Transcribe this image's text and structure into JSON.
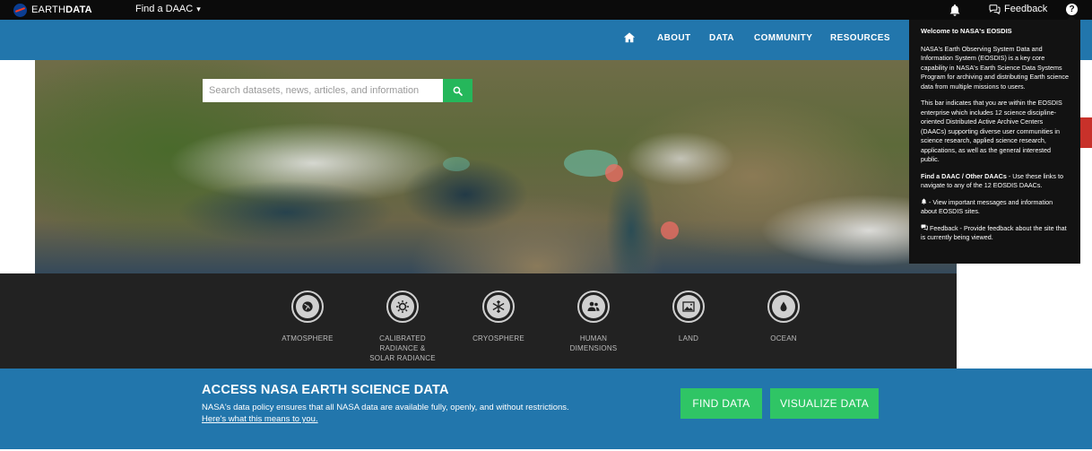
{
  "topbar": {
    "brand_light": "EARTH",
    "brand_bold": "DATA",
    "find_daac": "Find a DAAC",
    "find_daac_caret": "▾",
    "feedback": "Feedback",
    "help": "?"
  },
  "nav": {
    "about": "ABOUT",
    "data": "DATA",
    "community": "COMMUNITY",
    "resources": "RESOURCES"
  },
  "search": {
    "placeholder": "Search datasets, news, articles, and information"
  },
  "categories": [
    {
      "label_lines": [
        "ATMOSPHERE"
      ],
      "icon": "globe-icon"
    },
    {
      "label_lines": [
        "CALIBRATED",
        "RADIANCE &",
        "SOLAR RADIANCE"
      ],
      "icon": "sun-icon"
    },
    {
      "label_lines": [
        "CRYOSPHERE"
      ],
      "icon": "snowflake-icon"
    },
    {
      "label_lines": [
        "HUMAN",
        "DIMENSIONS"
      ],
      "icon": "people-icon"
    },
    {
      "label_lines": [
        "LAND"
      ],
      "icon": "landscape-icon"
    },
    {
      "label_lines": [
        "OCEAN"
      ],
      "icon": "water-drop-icon"
    }
  ],
  "banner": {
    "title": "ACCESS NASA EARTH SCIENCE DATA",
    "text": "NASA's data policy ensures that all NASA data are available fully, openly, and without restrictions.",
    "link": "Here's what this means to you.",
    "find_data": "FIND DATA",
    "visualize_data": "VISUALIZE DATA"
  },
  "popover": {
    "title": "Welcome to NASA's EOSDIS",
    "p1": "NASA's Earth Observing System Data and Information System (EOSDIS) is a key core capability in NASA's Earth Science Data Systems Program for archiving and distributing Earth science data from multiple missions to users.",
    "p2": "This bar indicates that you are within the EOSDIS enterprise which includes 12 science discipline-oriented Distributed Active Archive Centers (DAACs) supporting diverse user communities in science research, applied science research, applications, as well as the general interested public.",
    "p3_bold": "Find a DAAC / Other DAACs",
    "p3_rest": " - Use these links to navigate to any of the 12 EOSDIS DAACs.",
    "p4": " - View important messages and information about EOSDIS sites.",
    "p5": " Feedback - Provide feedback about the site that is currently being viewed."
  },
  "colors": {
    "topbar": "#0b0b0b",
    "nav_blue": "#2276ac",
    "green": "#2fc565",
    "dark_band": "#222222"
  }
}
